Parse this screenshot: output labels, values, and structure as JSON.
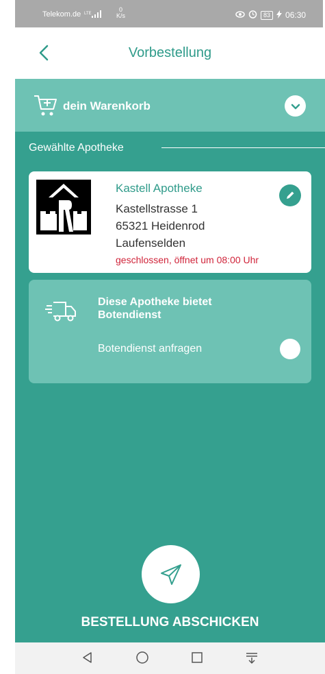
{
  "statusbar": {
    "carrier": "Telekom.de",
    "speed_value": "0",
    "speed_unit": "K/s",
    "battery": "83",
    "time": "06:30"
  },
  "header": {
    "title": "Vorbestellung",
    "back_icon": "chevron-left-icon"
  },
  "cart": {
    "label": "dein Warenkorb",
    "icon": "cart-plus-icon",
    "toggle_icon": "chevron-down-icon"
  },
  "pharmacy_section": {
    "label": "Gewählte Apotheke"
  },
  "pharmacy": {
    "name": "Kastell Apotheke",
    "street": "Kastellstrasse 1",
    "city": "65321 Heidenrod",
    "district": "Laufenselden",
    "status": "geschlossen, öffnet um 08:00 Uhr",
    "edit_icon": "pencil-icon"
  },
  "delivery": {
    "title": "Diese Apotheke bietet Botendienst",
    "request_label": "Botendienst anfragen",
    "icon": "delivery-truck-icon",
    "enabled": false
  },
  "submit": {
    "label": "BESTELLUNG ABSCHICKEN",
    "icon": "send-icon"
  },
  "colors": {
    "primary": "#35a08f",
    "panel": "#6ec2b4",
    "accent_text": "#2f9b8a",
    "status_closed": "#d0243a",
    "statusbar": "#a9a9a9"
  },
  "navbar": {
    "buttons": [
      "back-nav-icon",
      "home-nav-icon",
      "recents-nav-icon",
      "notifications-nav-icon"
    ]
  }
}
